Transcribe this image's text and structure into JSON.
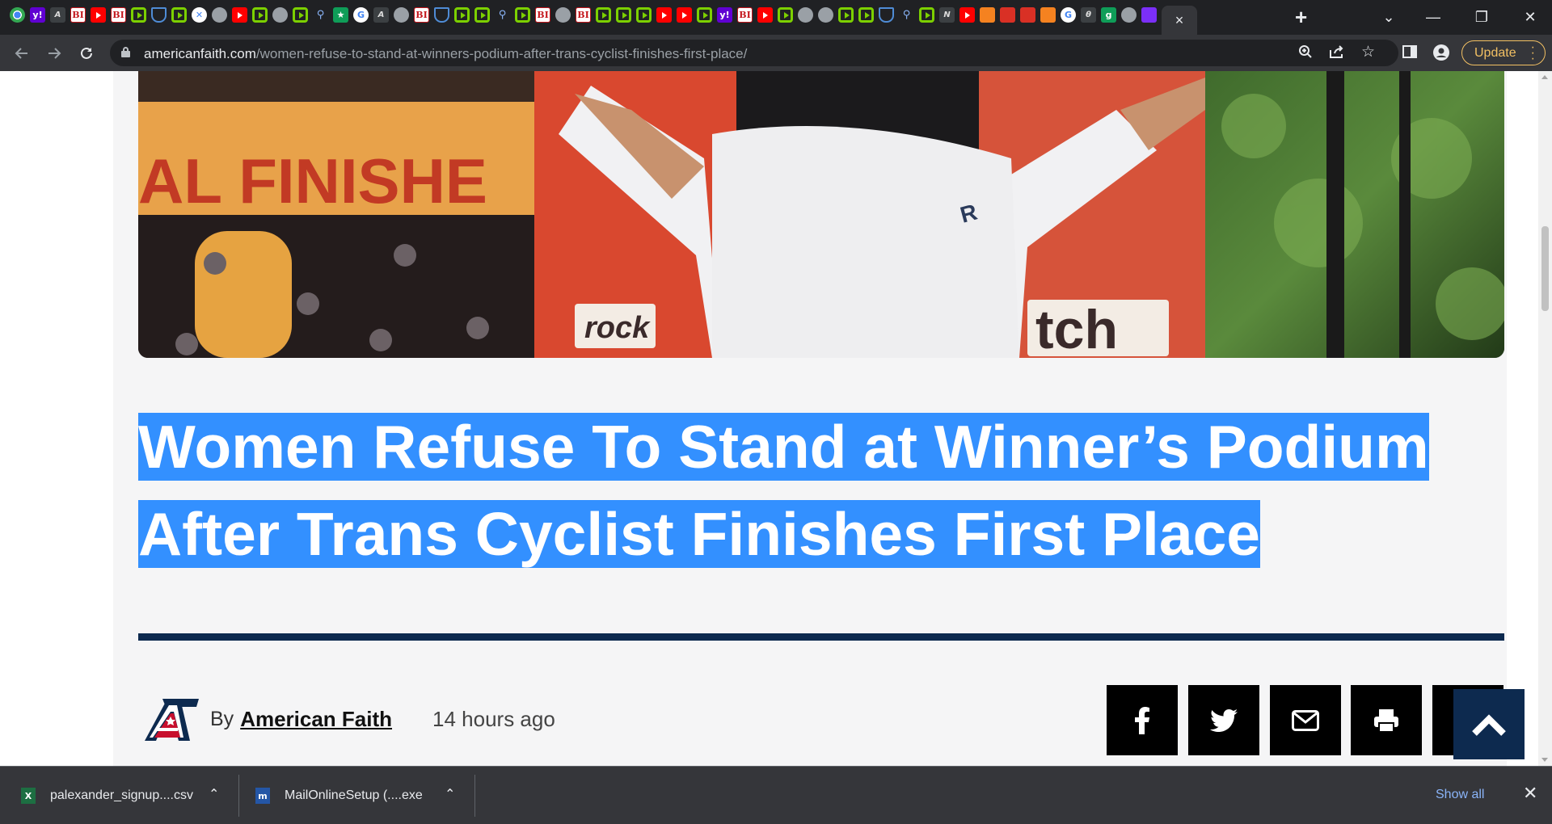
{
  "browser": {
    "tab_favicons": [
      "chrome-icon",
      "yahoo-icon",
      "abc-news-icon",
      "business-insider-icon",
      "youtube-icon",
      "business-insider-icon",
      "play-icon",
      "shield-icon",
      "play-icon",
      "map-icon",
      "globe-icon",
      "youtube-icon",
      "play-icon",
      "globe-icon",
      "play-icon",
      "search-icon",
      "starbucks-icon",
      "google-icon",
      "abc-news-icon",
      "globe-icon",
      "business-insider-icon",
      "shield-icon",
      "play-icon",
      "play-icon",
      "search-icon",
      "play-icon",
      "business-insider-icon",
      "globe-icon",
      "business-insider-icon",
      "play-icon",
      "play-icon",
      "play-icon",
      "youtube-icon",
      "youtube-icon",
      "play-icon",
      "yahoo-icon",
      "business-insider-icon",
      "youtube-icon",
      "play-icon",
      "globe-icon",
      "globe-icon",
      "play-icon",
      "play-icon",
      "shield-icon",
      "search-icon",
      "play-icon",
      "news-icon",
      "youtube-icon",
      "orange-icon",
      "red-icon",
      "red-icon",
      "orange-icon",
      "google-icon",
      "g-icon",
      "green-icon",
      "globe-icon",
      "purple-icon"
    ],
    "active_tab_close": "×",
    "new_tab": "+",
    "window_controls": {
      "tab_search": "⌄",
      "minimize": "—",
      "restore": "❐",
      "close": "✕"
    },
    "url_domain": "americanfaith.com",
    "url_path": "/women-refuse-to-stand-at-winners-podium-after-trans-cyclist-finishes-first-place/",
    "update_label": "Update"
  },
  "article": {
    "headline_line1": "Women Refuse To Stand at Winner’s Podium ",
    "headline_line2": "After Trans Cyclist Finishes First Place",
    "by_prefix": "By",
    "author": "American Faith",
    "time_ago": "14 hours ago",
    "hero_text": {
      "banner": "AL FINISHE",
      "sponsor_left": "rock",
      "sponsor_right": "tch"
    },
    "share_buttons": [
      "facebook-icon",
      "twitter-icon",
      "email-icon",
      "print-icon"
    ]
  },
  "downloads": {
    "items": [
      {
        "name": "palexander_signup....csv",
        "icon": "excel-icon"
      },
      {
        "name": "MailOnlineSetup (....exe",
        "icon": "installer-icon"
      }
    ],
    "show_all": "Show all"
  },
  "colors": {
    "selection": "#3390ff",
    "brand_navy": "#0d2a4f",
    "update_accent": "#f2c063"
  }
}
